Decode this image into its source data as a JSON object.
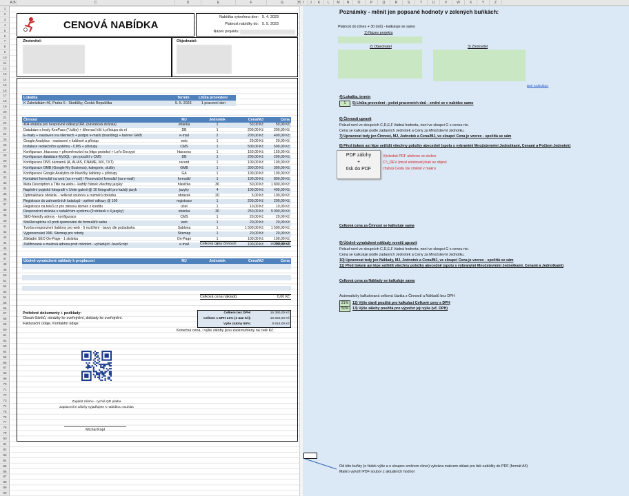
{
  "columns": [
    "A",
    "B",
    "C",
    "D",
    "E",
    "F",
    "G",
    "H",
    "I",
    "J",
    "K",
    "L",
    "M",
    "N",
    "O",
    "P",
    "Q",
    "R",
    "S",
    "T",
    "U",
    "V",
    "W",
    "X",
    "Y",
    "Z"
  ],
  "rows": [
    "1",
    "2",
    "3",
    "4",
    "5",
    "6",
    "7",
    "8",
    "9",
    "10",
    "11",
    "12",
    "13",
    "14",
    "15",
    "16",
    "17",
    "18",
    "19",
    "20",
    "21",
    "22",
    "23",
    "24",
    "25",
    "26",
    "27",
    "28",
    "29",
    "30",
    "31",
    "32",
    "33",
    "34",
    "35",
    "36",
    "37",
    "38",
    "39",
    "40",
    "41",
    "42",
    "43",
    "44",
    "45",
    "46",
    "47",
    "48",
    "49",
    "50",
    "51",
    "52",
    "53",
    "54",
    "55",
    "56",
    "57",
    "58",
    "59",
    "60",
    "61",
    "62",
    "63",
    "64",
    "65",
    "66",
    "67",
    "68",
    "69",
    "70",
    "71",
    "72",
    "73",
    "74",
    "75",
    "76",
    "77",
    "78",
    "79",
    "80",
    "81",
    "82",
    "83",
    "84",
    "85",
    "86",
    "87",
    "88",
    "89",
    "90"
  ],
  "document": {
    "title": "CENOVÁ NABÍDKA",
    "meta": {
      "created_label": "Nabídka vytvořena dne:",
      "created_value": "5. 4. 2023",
      "valid_label": "Platnost nabídky do:",
      "valid_value": "5. 5. 2023",
      "project_label": "Název projektu:"
    },
    "contractor_label": "Zhotovitel:",
    "client_label": "Objednatel:",
    "location": {
      "h1": "Lokalita",
      "h2": "Termín",
      "h3": "Lhůta provedení",
      "address": "K Zahrádkám 46, Praha 5 - Stodůlky, Česká Republika",
      "date": "5. 5. 2023",
      "duration": "1 pracovní den"
    },
    "activities": {
      "headers": [
        "Činnost",
        "MJ",
        "Jednotek",
        "Cena/MJ",
        "Cena"
      ],
      "rows": [
        [
          "404 stránka pro nesprávné odkazy/URL (návratová stránka)",
          "stránka",
          "1",
          "50,00 Kč",
          "50,00 Kč"
        ],
        [
          "Databáze s hesly KeePass (*.kdbx) + šifrovací klíč k přístupu do ní",
          "DB",
          "1",
          "200,00 Kč",
          "200,00 Kč"
        ],
        [
          "E-maily + nastavení na klientech + podpis e-mailů (branding) + banner GMB",
          "e-mail",
          "2",
          "200,00 Kč",
          "400,00 Kč"
        ],
        [
          "Google Analytics - nastavení v šabloně a přístup",
          "web",
          "1",
          "20,00 Kč",
          "20,00 Kč"
        ],
        [
          "Instalace redakčního systému - CMS + přístupy",
          "CMS",
          "1",
          "500,00 Kč",
          "500,00 Kč"
        ],
        [
          "Konfigurace .htaccess + přesměrování na https protokol + Let's Encrypt",
          "htaccess",
          "1",
          "150,00 Kč",
          "150,00 Kč"
        ],
        [
          "Konfigurace databáze MySQL - pro použití v CMS",
          "DB",
          "1",
          "200,00 Kč",
          "200,00 Kč"
        ],
        [
          "Konfigurace DNS záznamů (A, ALIAS, CNAME, MX, TXT)",
          "record",
          "1",
          "100,00 Kč",
          "100,00 Kč"
        ],
        [
          "Konfigurace GMB (Google My Business), kategorie, služby",
          "GMB",
          "1",
          "300,00 Kč",
          "300,00 Kč"
        ],
        [
          "Konfigurace Google Analytics do hlavičky šablony + přístupy",
          "GA",
          "1",
          "100,00 Kč",
          "100,00 Kč"
        ],
        [
          "Kontaktní formulář na web (na e-mail) / Rezervační formulář (na e-mail)",
          "formulář",
          "1",
          "100,00 Kč",
          "800,00 Kč"
        ],
        [
          "Meta Description a Title na webu - každý článek všechny jazyky",
          "hlavička",
          "36",
          "50,00 Kč",
          "1 800,00 Kč"
        ],
        [
          "Naplnění popisků fotografií v Unite galerii @ 10 fotografií pro každý jazyk",
          "jazyky",
          "4",
          "100,00 Kč",
          "400,00 Kč"
        ],
        [
          "Optimalizace obrázku - velikost souboru a rozměrů obrázku",
          "obrázek",
          "20",
          "5,00 Kč",
          "100,00 Kč"
        ],
        [
          "Registrace do zahraničních katalogů - zpětné odkazy @ 100",
          "registrace",
          "1",
          "200,00 Kč",
          "200,00 Kč"
        ],
        [
          "Registrace na tele3.cz pro obnovu domén z kreditu",
          "účet",
          "1",
          "10,00 Kč",
          "10,00 Kč"
        ],
        [
          "Responzivní stránka v redakčním systému (9 stránek x 4 jazyky)",
          "stránka",
          "36",
          "250,00 Kč",
          "9 000,00 Kč"
        ],
        [
          "SEO-friendly adresy - konfigurace",
          "CMS",
          "1",
          "20,00 Kč",
          "20,00 Kč"
        ],
        [
          "SiteRecaptcha v3 proti spamování do formulářů webu",
          "web",
          "1",
          "20,00 Kč",
          "20,00 Kč"
        ],
        [
          "Tvorba responzivní šablony pro web - 5 rozšíření - barvy dle požadavku",
          "Šablona",
          "1",
          "1 500,00 Kč",
          "1 500,00 Kč"
        ],
        [
          "Vygenerování XML Sitemap pro roboty",
          "Sitemap",
          "1",
          "20,00 Kč",
          "20,00 Kč"
        ],
        [
          "Základní SEO On-Page - 1 stránka",
          "On-Page",
          "1",
          "100,00 Kč",
          "100,00 Kč"
        ],
        [
          "Zašifrovaná e-mailová adresa proti robotům - vyžadující JavaScript",
          "e-mail",
          "2",
          "100,00 Kč",
          "200,00 Kč"
        ]
      ],
      "total_label": "Celková cena činností:",
      "total_value": "16 390,00 Kč"
    },
    "costs": {
      "headers": [
        "Účelně vynaložené náklady k proplacení",
        "MJ",
        "Jednotek",
        "Cena/MJ",
        "Cena"
      ],
      "total_label": "Celková cena nákladů:",
      "total_value": "0,00 Kč"
    },
    "docs": {
      "title": "Potřebné dokumenty + podklady:",
      "line1": "Obsah článků, obrázky ke zveřejnění, doklady ke zveřejnění.",
      "line2": "Fakturační údaje, Kontaktní údaje."
    },
    "summary": [
      {
        "label": "Celkem bez DPH:",
        "value": "16 390,00 Kč"
      },
      {
        "label": "Celkem s DPH 21% (3 442 Kč):",
        "value": "19 832,00 Kč"
      },
      {
        "label": "Výše zálohy 50%:",
        "value": "9 916,00 Kč"
      }
    ],
    "rounding_note": "Konečná cena, i výše zálohy jsou zaokrouhleny na celé Kč.",
    "qr_caption1": "Zaplatit zálohu - rychlá QR platba",
    "qr_caption2": "Zaplacením zálohy vyjadřujete s nabídkou souhlas",
    "signature": "Michal Kopl"
  },
  "notes": {
    "title": "Poznámky - měnit jen popsané hodnoty v zelených buňkách:",
    "validity_note": "Platnost do (dnes + 30 dnů) - kalkuluje se samo",
    "label_project": "1) Název projektu",
    "label_client": "2) Objednatel",
    "label_contractor": "3) Zhotovitel",
    "calc_link": "BMI Kalkulátor",
    "s4_title": "4) Lokalita, termín",
    "s5_value": "1",
    "s5_text": "5) Lhůta provedení - počet pracovních dnů - změní se v nabídce samo",
    "s6_title": "6) Činnosti upravit",
    "s6_l1": "Pokud není ve sloupcích C,D,E,F žádná hodnota, není ve sloupci G s cenou nic.",
    "s6_l2": "Cena se kalkuluje podle zadaných Jednotek a Ceny za Množstevní Jednotku.",
    "s7": "7) Upravovat tedy jen Činnost, MJ, Jednotek a Cenu/MJ, ve sloupci Cena je vzorec - spočítá se sám",
    "s8": "8) Před tiskem asi lépe setřídit všechny položky abecedně (spolu s vybraními Množstevními Jednotkami, Cenami a Počtem Jednotek)",
    "button": "PDF zálohy\n+\ntisk do PDF",
    "pdf_note1": "Výsledné PDF uloženo ve složce",
    "pdf_note2": "C:\\_DEV (musí existovat jinak se objeví",
    "pdf_note3": "chyba)     Cestu lze změnit v makru",
    "total_note1": "Celková cena za Činnost se kalkuluje sama",
    "s9_title": "9) Účelně vynaložené náklady rovněž upravit",
    "s9_l1": "Pokud není ve sloupcích C,D,E,F žádná hodnota, není ve sloupci G s cenou nic.",
    "s9_l2": "Cena se kalkuluje podle zadaných Jednotek a Ceny za Množstevní Jednotku.",
    "s10": "10) Upravovat tedy jen Náklady, MJ, Jednotek a Cenu/MJ, ve sloupci Cena je vzorec - spočítá se sám",
    "s11": "11) Před tiskem asi lépe setřídit všechny položky abecedně (spolu s vybranými Množstevními Jednotkami, Cenami a Jednotkami)",
    "total_note2": "Celková cena za Náklady se kalkuluje sama",
    "auto_note": "Automaticky kalkulovaná celková částka z Činností a Nákladů bez DPH",
    "s12_value": "21%",
    "s12_text": "12) Výše daně použitá pro kalkulaci Celkové ceny s DPH",
    "s13_value": "50%",
    "s13_text": "13) Výše zálohy použitá pro výpočet její výše (vč. DPH)",
    "bottom1": "Od této buňky (o řádek výše a o sloupec směrem vlevo) vybrána makrem oblast pro tisk nabídky do PDF (formát A4)",
    "bottom2": "Makro vytvoří PDF soubor z aktuálních hodnot"
  }
}
